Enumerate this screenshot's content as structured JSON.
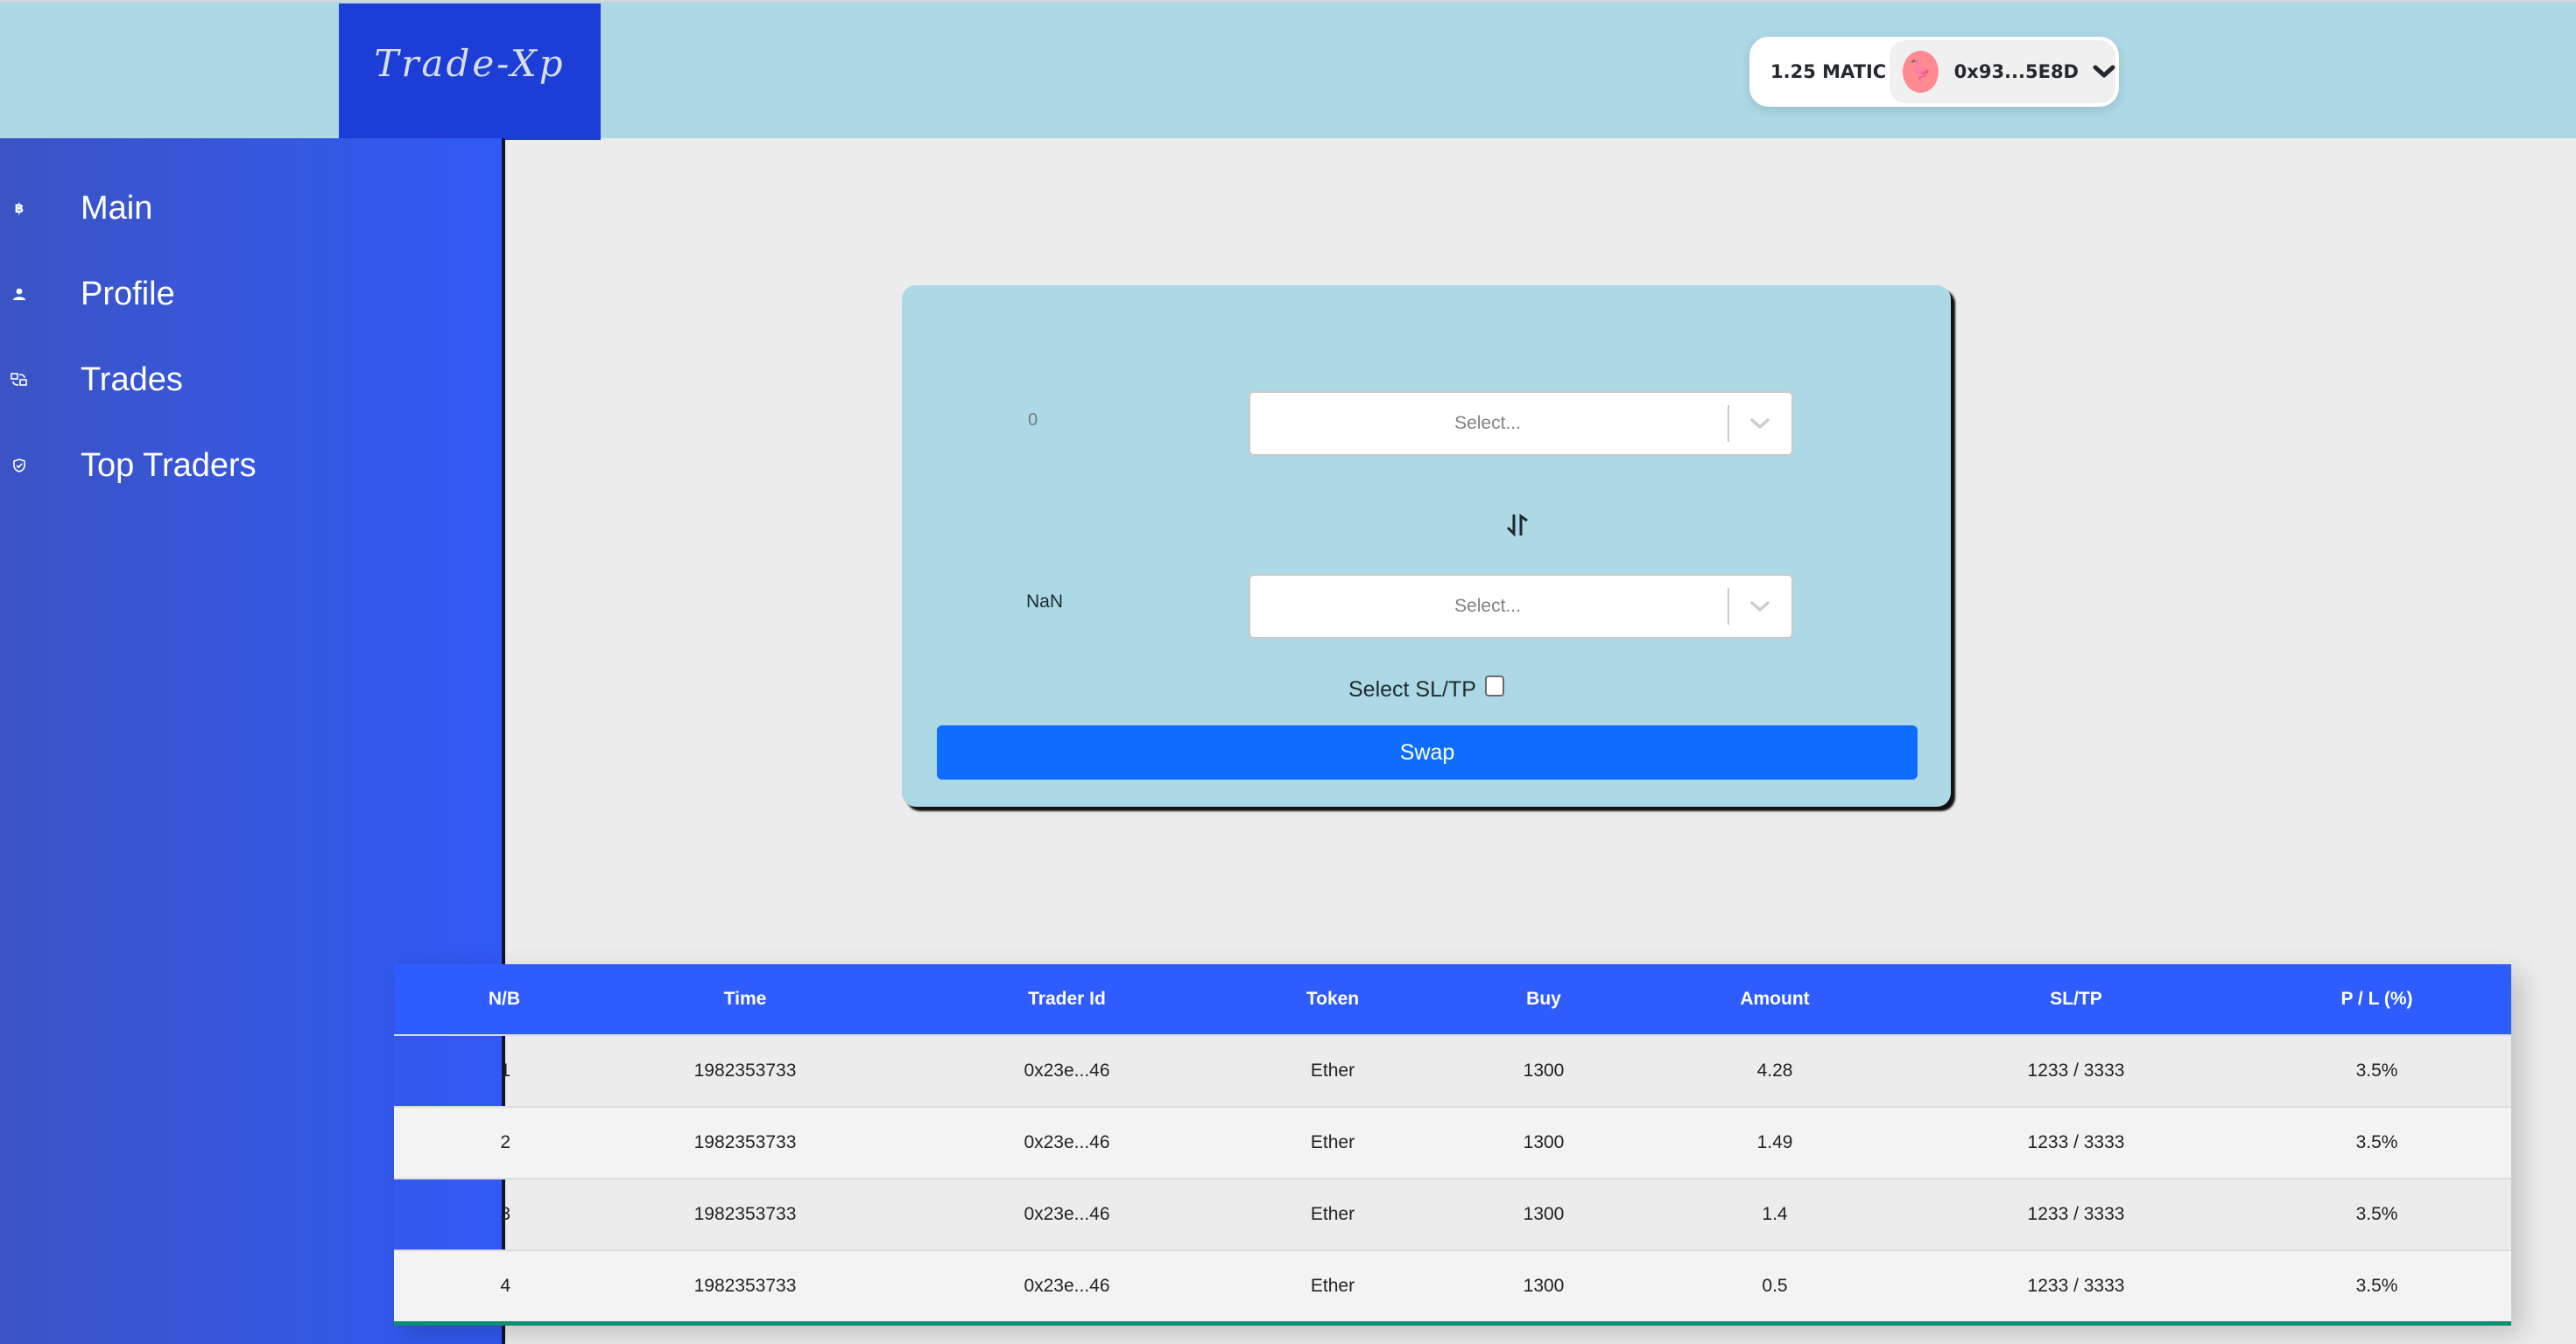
{
  "header": {
    "logo_text": "Trade-Xp",
    "wallet": {
      "balance": "1.25 MATIC",
      "avatar_icon": "flamingo-icon",
      "avatar_glyph": "🦩",
      "address": "0x93...5E8D",
      "chevron_icon": "chevron-down-icon"
    }
  },
  "sidebar": {
    "items": [
      {
        "label": "Main",
        "icon": "bitcoin-icon",
        "glyph": "฿"
      },
      {
        "label": "Profile",
        "icon": "user-icon"
      },
      {
        "label": "Trades",
        "icon": "exchange-icon"
      },
      {
        "label": "Top Traders",
        "icon": "shield-check-icon"
      }
    ]
  },
  "swap_card": {
    "from_amount": {
      "value": "",
      "placeholder": "0"
    },
    "to_amount": "NaN",
    "from_token_select": {
      "placeholder": "Select..."
    },
    "to_token_select": {
      "placeholder": "Select..."
    },
    "swap_direction_icon": "swap-vertical-icon",
    "sltp_label": "Select SL/TP",
    "sltp_checked": false,
    "swap_button_label": "Swap"
  },
  "trades_table": {
    "columns": [
      "N/B",
      "Time",
      "Trader Id",
      "Token",
      "Buy",
      "Amount",
      "SL/TP",
      "P / L (%)"
    ],
    "rows": [
      [
        "1",
        "1982353733",
        "0x23e...46",
        "Ether",
        "1300",
        "4.28",
        "1233 / 3333",
        "3.5%"
      ],
      [
        "2",
        "1982353733",
        "0x23e...46",
        "Ether",
        "1300",
        "1.49",
        "1233 / 3333",
        "3.5%"
      ],
      [
        "3",
        "1982353733",
        "0x23e...46",
        "Ether",
        "1300",
        "1.4",
        "1233 / 3333",
        "3.5%"
      ],
      [
        "4",
        "1982353733",
        "0x23e...46",
        "Ether",
        "1300",
        "0.5",
        "1233 / 3333",
        "3.5%"
      ]
    ]
  },
  "colors": {
    "header_bg": "#add8e6",
    "logo_bg": "#1c3ed6",
    "sidebar_gradient_start": "#3b53c4",
    "sidebar_gradient_end": "#3159f5",
    "card_bg": "#add8e6",
    "swap_button": "#0d6efd",
    "table_header": "#2f5cff",
    "table_bottom_border": "#0b8f72",
    "main_bg": "#ececec"
  }
}
